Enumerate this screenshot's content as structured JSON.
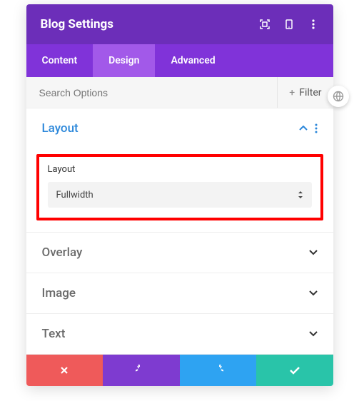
{
  "header": {
    "title": "Blog Settings"
  },
  "tabs": {
    "items": [
      {
        "label": "Content",
        "active": false
      },
      {
        "label": "Design",
        "active": true
      },
      {
        "label": "Advanced",
        "active": false
      }
    ]
  },
  "search": {
    "placeholder": "Search Options",
    "filter_label": "Filter"
  },
  "sections": {
    "layout": {
      "title": "Layout",
      "field_label": "Layout",
      "selected_value": "Fullwidth"
    },
    "overlay": {
      "title": "Overlay"
    },
    "image": {
      "title": "Image"
    },
    "text": {
      "title": "Text"
    }
  },
  "colors": {
    "header": "#6c2eb9",
    "tabs_bg": "#8033d9",
    "tab_active": "#a259e9",
    "accent_blue": "#2b87da",
    "highlight": "#ff0000",
    "btn_red": "#ef5a5a",
    "btn_purple": "#7e3bd0",
    "btn_blue": "#2ea3f2",
    "btn_green": "#29c4a9"
  }
}
